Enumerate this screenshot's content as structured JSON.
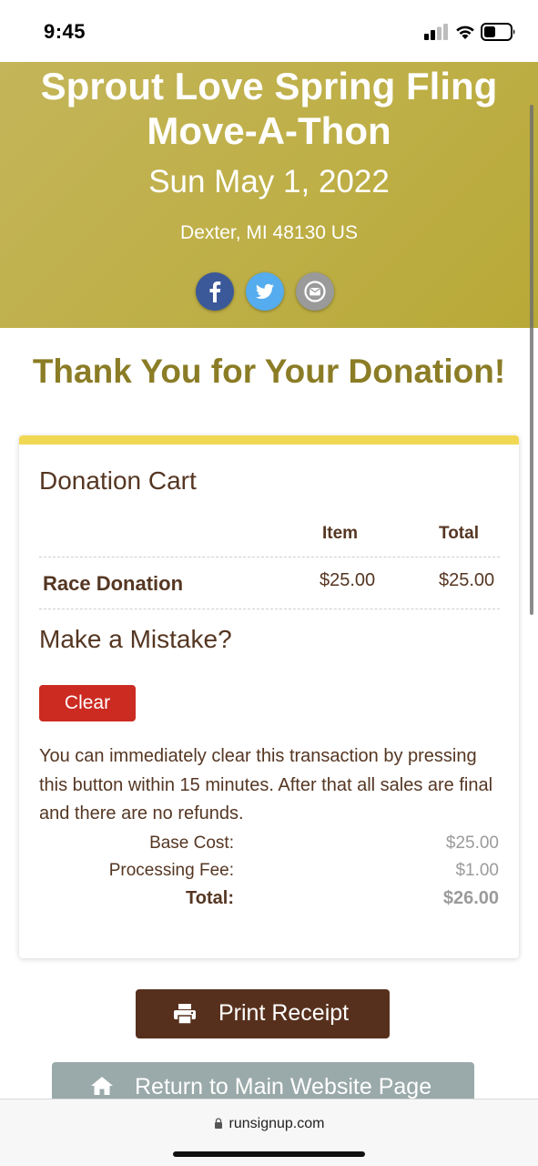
{
  "status_bar": {
    "time": "9:45"
  },
  "event": {
    "title": "Sprout Love Spring Fling Move-A-Thon",
    "date": "Sun May 1, 2022",
    "location": "Dexter, MI 48130 US"
  },
  "social": [
    "facebook-icon",
    "twitter-icon",
    "email-icon"
  ],
  "thank_you": "Thank You for Your Donation!",
  "cart": {
    "title": "Donation Cart",
    "columns": {
      "item": "Item",
      "total": "Total"
    },
    "rows": [
      {
        "name": "Race Donation",
        "item": "$25.00",
        "total": "$25.00"
      }
    ]
  },
  "mistake": {
    "heading": "Make a Mistake?",
    "clear_label": "Clear",
    "note": "You can immediately clear this transaction by pressing this button within 15 minutes. After that all sales are final and there are no refunds."
  },
  "summary": {
    "base_label": "Base Cost:",
    "base_value": "$25.00",
    "fee_label": "Processing Fee:",
    "fee_value": "$1.00",
    "total_label": "Total:",
    "total_value": "$26.00"
  },
  "actions": {
    "print_label": "Print Receipt",
    "return_label": "Return to Main Website Page"
  },
  "browser": {
    "url": "runsignup.com"
  },
  "colors": {
    "hero": "#bfb04a",
    "heading_olive": "#8b7c26",
    "text_brown": "#553622",
    "accent_yellow": "#f0d855",
    "clear_red": "#cc2b22",
    "print_brown": "#57301d",
    "return_gray": "#9aa9a9"
  }
}
